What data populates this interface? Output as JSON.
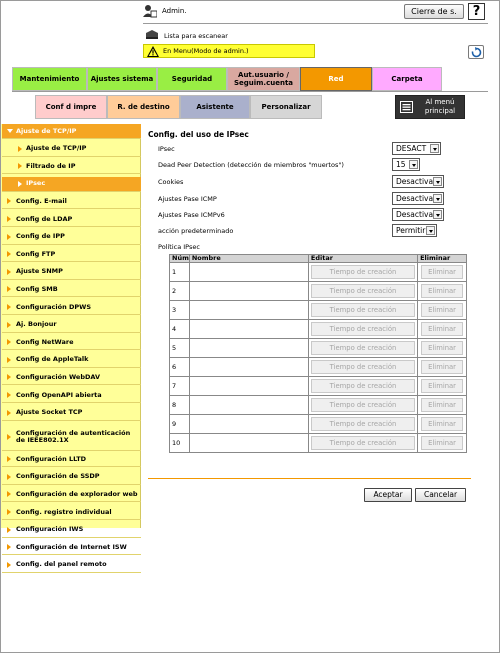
{
  "header": {
    "user": "Admin.",
    "logout_label": "Cierre de s.",
    "help_label": "?",
    "scan_list": "Lista para escanear",
    "mode_text": "En Menu(Modo de admin.)"
  },
  "tabs_row1": [
    {
      "label": "Mantenimiento",
      "color": "#99ee44"
    },
    {
      "label": "Ajustes sistema",
      "color": "#99ee44"
    },
    {
      "label": "Seguridad",
      "color": "#99ee44"
    },
    {
      "label": "Aut.usuario / Seguim.cuenta",
      "color": "#d9a8a0"
    },
    {
      "label": "Red",
      "color": "#f39800"
    },
    {
      "label": "Carpeta",
      "color": "#ffaaff"
    }
  ],
  "tabs_row2": [
    {
      "label": "Conf d impre",
      "color": "#ffcccc"
    },
    {
      "label": "R. de destino",
      "color": "#ffcc99"
    },
    {
      "label": "Asistente",
      "color": "#aab0cc"
    },
    {
      "label": "Personalizar",
      "color": "#d6d6d6"
    }
  ],
  "menu_button": "Al menú principal",
  "sidebar": [
    {
      "label": "Ajuste de TCP/IP",
      "kind": "open"
    },
    {
      "label": "Ajuste de TCP/IP",
      "kind": "sub"
    },
    {
      "label": "Filtrado de IP",
      "kind": "sub"
    },
    {
      "label": "IPsec",
      "kind": "sub-sel"
    },
    {
      "label": "Config. E-mail",
      "kind": "item"
    },
    {
      "label": "Config de LDAP",
      "kind": "item"
    },
    {
      "label": "Config de IPP",
      "kind": "item"
    },
    {
      "label": "Config FTP",
      "kind": "item"
    },
    {
      "label": "Ajuste SNMP",
      "kind": "item"
    },
    {
      "label": "Config SMB",
      "kind": "item"
    },
    {
      "label": "Configuración DPWS",
      "kind": "item"
    },
    {
      "label": "Aj. Bonjour",
      "kind": "item"
    },
    {
      "label": "Config NetWare",
      "kind": "item"
    },
    {
      "label": "Config de AppleTalk",
      "kind": "item"
    },
    {
      "label": "Configuración WebDAV",
      "kind": "item"
    },
    {
      "label": "Config OpenAPI abierta",
      "kind": "item"
    },
    {
      "label": "Ajuste Socket TCP",
      "kind": "item"
    },
    {
      "label": "Configuración de autenticación de IEEE802.1X",
      "kind": "tall"
    },
    {
      "label": "Configuración LLTD",
      "kind": "item"
    },
    {
      "label": "Configuración de SSDP",
      "kind": "item"
    },
    {
      "label": "Configuración de explorador web",
      "kind": "item"
    },
    {
      "label": "Config. registro individual",
      "kind": "item"
    },
    {
      "label": "Configuración IWS",
      "kind": "item"
    },
    {
      "label": "Configuración de Internet ISW",
      "kind": "item"
    },
    {
      "label": "Config. del panel remoto",
      "kind": "item"
    }
  ],
  "content": {
    "title": "Config. del uso de IPsec",
    "rows": [
      {
        "label": "IPsec",
        "value": "DESACT"
      },
      {
        "label": "Dead Peer Detection (detección de miembros \"muertos\")",
        "value": "15"
      },
      {
        "label": "Cookies",
        "value": "Desactivar"
      },
      {
        "label": "Ajustes Pase ICMP",
        "value": "Desactivar"
      },
      {
        "label": "Ajustes Pase ICMPv6",
        "value": "Desactivar"
      },
      {
        "label": "acción predeterminado",
        "value": "Permitir"
      }
    ],
    "policy_label": "Política IPsec",
    "table_headers": [
      "Núm",
      "Nombre",
      "Editar",
      "Eliminar"
    ],
    "table_rows": [
      {
        "num": "1",
        "name": "",
        "edit": "Tiempo de creación",
        "del": "Eliminar"
      },
      {
        "num": "2",
        "name": "",
        "edit": "Tiempo de creación",
        "del": "Eliminar"
      },
      {
        "num": "3",
        "name": "",
        "edit": "Tiempo de creación",
        "del": "Eliminar"
      },
      {
        "num": "4",
        "name": "",
        "edit": "Tiempo de creación",
        "del": "Eliminar"
      },
      {
        "num": "5",
        "name": "",
        "edit": "Tiempo de creación",
        "del": "Eliminar"
      },
      {
        "num": "6",
        "name": "",
        "edit": "Tiempo de creación",
        "del": "Eliminar"
      },
      {
        "num": "7",
        "name": "",
        "edit": "Tiempo de creación",
        "del": "Eliminar"
      },
      {
        "num": "8",
        "name": "",
        "edit": "Tiempo de creación",
        "del": "Eliminar"
      },
      {
        "num": "9",
        "name": "",
        "edit": "Tiempo de creación",
        "del": "Eliminar"
      },
      {
        "num": "10",
        "name": "",
        "edit": "Tiempo de creación",
        "del": "Eliminar"
      }
    ],
    "ok_label": "Aceptar",
    "cancel_label": "Cancelar"
  }
}
